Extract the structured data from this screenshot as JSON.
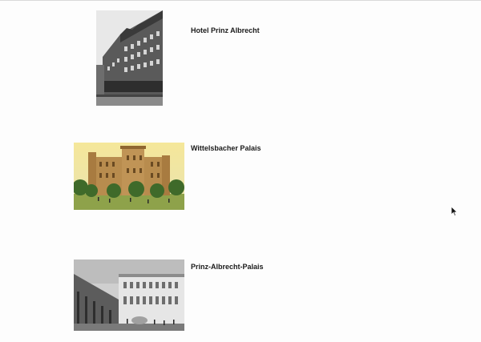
{
  "entries": [
    {
      "title": "Hotel Prinz Albrecht",
      "image": "hotel-building-photo"
    },
    {
      "title": "Wittelsbacher Palais",
      "image": "palace-painting"
    },
    {
      "title": "Prinz-Albrecht-Palais",
      "image": "palace-engraving"
    }
  ],
  "colors": {
    "background": "#fdfdfd",
    "title_text": "#1a1a1a",
    "rule": "#d9d9d9"
  },
  "icons": [
    "mouse-cursor-icon"
  ]
}
